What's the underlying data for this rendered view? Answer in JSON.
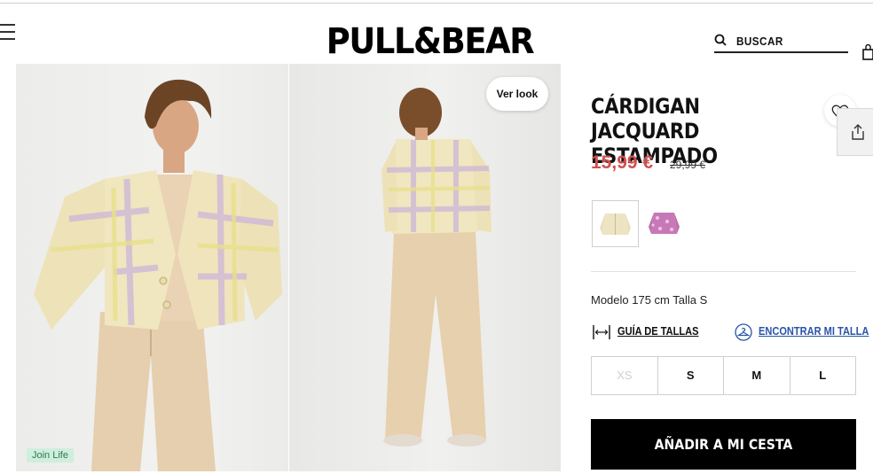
{
  "header": {
    "logo": "PULL&BEAR",
    "search_label": "BUSCAR"
  },
  "gallery": {
    "badge": "Join Life",
    "look_button": "Ver look"
  },
  "product": {
    "title": "CÁRDIGAN JACQUARD ESTAMPADO",
    "price": "15,99 €",
    "old_price": "29,99 €",
    "price_color": "#d0504e",
    "model_info": "Modelo 175 cm Talla S",
    "size_guide_label": "GUÍA DE TALLAS",
    "find_size_label": "ENCONTRAR MI TALLA",
    "link_color": "#2b55a8",
    "sizes": [
      {
        "label": "XS",
        "available": false
      },
      {
        "label": "S",
        "available": true
      },
      {
        "label": "M",
        "available": true
      },
      {
        "label": "L",
        "available": true
      }
    ],
    "add_to_cart": "AÑADIR A MI CESTA",
    "colors": [
      "cream-yellow-lilac-check",
      "pink-purple-floral"
    ]
  },
  "icons": [
    "menu-icon",
    "search-icon",
    "bag-icon",
    "heart-icon",
    "share-icon",
    "ruler-icon",
    "hanger-icon"
  ]
}
